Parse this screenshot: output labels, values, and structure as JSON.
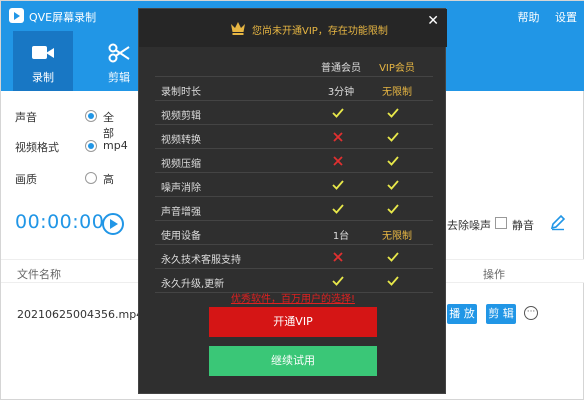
{
  "app": {
    "title": "QVE屏幕录制",
    "help": "帮助",
    "settings": "设置"
  },
  "toolbar": {
    "record": "录制",
    "edit": "剪辑"
  },
  "settings": {
    "audio_label": "声音",
    "audio_value": "全部",
    "format_label": "视频格式",
    "format_value": "mp4",
    "quality_label": "画质",
    "quality_value": "高"
  },
  "recorder": {
    "timer": "00:00:00",
    "denoise": "去除噪声",
    "mute": "静音"
  },
  "list": {
    "col_name": "文件名称",
    "col_op": "操作",
    "files": [
      {
        "name": "20210625004356.mp4",
        "play": "播 放",
        "edit": "剪 辑"
      }
    ]
  },
  "vip": {
    "title": "您尚未开通VIP，存在功能限制",
    "col_normal": "普通会员",
    "col_vip": "VIP会员",
    "rows": [
      {
        "feature": "录制时长",
        "normal": "3分钟",
        "vip": "无限制"
      },
      {
        "feature": "视频剪辑",
        "normal": "check",
        "vip": "check"
      },
      {
        "feature": "视频转换",
        "normal": "cross",
        "vip": "check"
      },
      {
        "feature": "视频压缩",
        "normal": "cross",
        "vip": "check"
      },
      {
        "feature": "噪声消除",
        "normal": "check",
        "vip": "check"
      },
      {
        "feature": "声音增强",
        "normal": "check",
        "vip": "check"
      },
      {
        "feature": "使用设备",
        "normal": "1台",
        "vip": "无限制"
      },
      {
        "feature": "永久技术客服支持",
        "normal": "cross",
        "vip": "check"
      },
      {
        "feature": "永久升级,更新",
        "normal": "check",
        "vip": "check"
      }
    ],
    "promo": "优秀软件，百万用户的选择!",
    "btn_vip": "开通VIP",
    "btn_trial": "继续试用"
  },
  "colors": {
    "primary": "#2196e6",
    "gold": "#e7b643",
    "red": "#d51515",
    "green": "#3ac777",
    "check": "#e8e84a",
    "cross": "#e03030"
  }
}
